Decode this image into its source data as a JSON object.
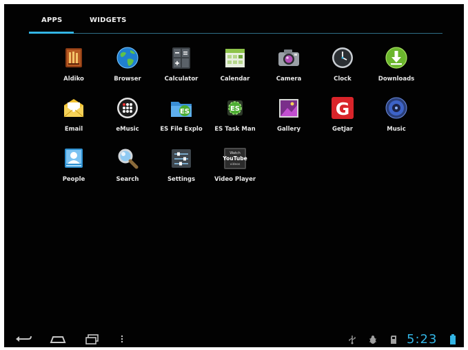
{
  "tabs": [
    {
      "label": "APPS",
      "active": true
    },
    {
      "label": "WIDGETS",
      "active": false
    }
  ],
  "accent_color": "#33b5e5",
  "apps": [
    {
      "label": "Aldiko",
      "icon": "aldiko-icon"
    },
    {
      "label": "Browser",
      "icon": "globe-icon"
    },
    {
      "label": "Calculator",
      "icon": "calculator-icon"
    },
    {
      "label": "Calendar",
      "icon": "calendar-icon"
    },
    {
      "label": "Camera",
      "icon": "camera-icon"
    },
    {
      "label": "Clock",
      "icon": "clock-icon"
    },
    {
      "label": "Downloads",
      "icon": "download-icon"
    },
    {
      "label": "Email",
      "icon": "email-icon"
    },
    {
      "label": "eMusic",
      "icon": "emusic-icon"
    },
    {
      "label": "ES File Explo",
      "icon": "es-file-explorer-icon"
    },
    {
      "label": "ES Task Man",
      "icon": "es-task-manager-icon"
    },
    {
      "label": "Gallery",
      "icon": "gallery-icon"
    },
    {
      "label": "GetJar",
      "icon": "getjar-icon"
    },
    {
      "label": "Music",
      "icon": "music-icon"
    },
    {
      "label": "People",
      "icon": "people-icon"
    },
    {
      "label": "Search",
      "icon": "search-icon"
    },
    {
      "label": "Settings",
      "icon": "settings-icon"
    },
    {
      "label": "Video Player",
      "icon": "video-player-icon"
    }
  ],
  "video_icon_text": {
    "line1": "Watch",
    "line2": "YouTube",
    "line3": "videos"
  },
  "getjar_letter": "G",
  "status_bar": {
    "time": "5:23",
    "icons": [
      "usb-icon",
      "debug-icon",
      "sd-card-icon",
      "battery-icon"
    ]
  },
  "nav_buttons": [
    "back-icon",
    "home-icon",
    "recent-apps-icon",
    "menu-icon"
  ]
}
